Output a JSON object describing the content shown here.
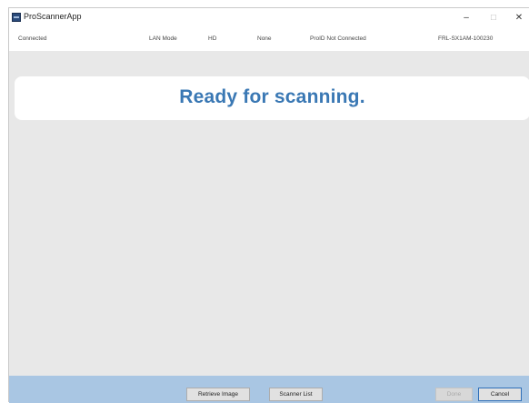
{
  "window": {
    "title": "ProScannerApp",
    "controls": {
      "minimize": "–",
      "maximize": "☐",
      "close": "✕"
    }
  },
  "status": {
    "connection": "Connected",
    "mode": "LAN Mode",
    "resolution": "HD",
    "option": "None",
    "proid": "ProID Not Connected",
    "device": "FRL-SX1AM-100230"
  },
  "main": {
    "message": "Ready for scanning."
  },
  "footer": {
    "retrieve_image": "Retrieve Image",
    "scanner_list": "Scanner List",
    "done": "Done",
    "cancel": "Cancel"
  },
  "colors": {
    "message": "#3a78b4",
    "footer_bar": "#a9c6e3",
    "panel": "#e8e8e8"
  }
}
